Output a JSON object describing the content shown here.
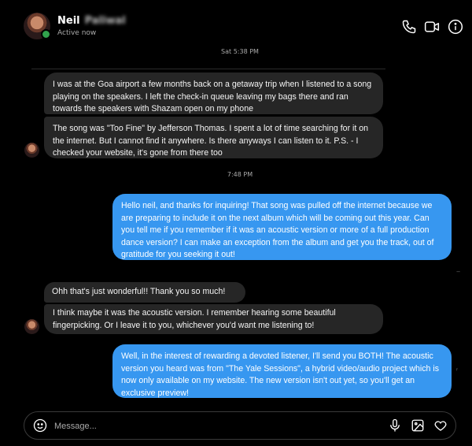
{
  "header": {
    "name": "Neil",
    "name_redacted": "Paliwal",
    "status": "Active now"
  },
  "timestamps": {
    "first": "Sat 5:38 PM",
    "second": "7:48 PM"
  },
  "messages": [
    {
      "from": "them",
      "text": "I was at the Goa airport a few months back on a getaway trip when I listened to a song playing on the speakers. I left the check-in queue leaving my bags there and ran towards the speakers with Shazam open on my phone"
    },
    {
      "from": "them",
      "text": "The song was \"Too Fine\" by Jefferson Thomas. I spent a lot of time searching for it on the internet. But I cannot find it anywhere. Is there anyways I can listen to it. P.S. - I checked your website, it's gone from there too"
    },
    {
      "from": "me",
      "text": "Hello neil, and thanks for inquiring! That song was pulled off the internet because we are preparing to include it on the next album which will be coming out this year. Can you tell me if you remember if it was an acoustic version or more of a full production dance version? I can make an exception from the album and get you the track, out of gratitude for you seeking it out!"
    },
    {
      "from": "them",
      "text": "Ohh that's just wonderful!! Thank you so much!"
    },
    {
      "from": "them",
      "text": "I think maybe it was the acoustic version. I remember hearing some beautiful fingerpicking. Or I  leave it to you, whichever you'd want me listening to!"
    },
    {
      "from": "me",
      "text": "Well, in the interest of rewarding a devoted listener, I'll send you BOTH!  The acoustic version you heard was from \"The Yale Sessions\", a hybrid video/audio project which is now only available on my website.  The new version isn't out yet, so you'll get an exclusive preview!"
    }
  ],
  "composer": {
    "placeholder": "Message..."
  },
  "icons": {
    "call": "phone-icon",
    "video": "video-icon",
    "info": "info-icon",
    "emoji": "emoji-icon",
    "mic": "microphone-icon",
    "gallery": "image-icon",
    "like": "heart-icon"
  },
  "colors": {
    "outgoing": "#3797f0",
    "incoming": "#262626",
    "online": "#31a24c"
  }
}
